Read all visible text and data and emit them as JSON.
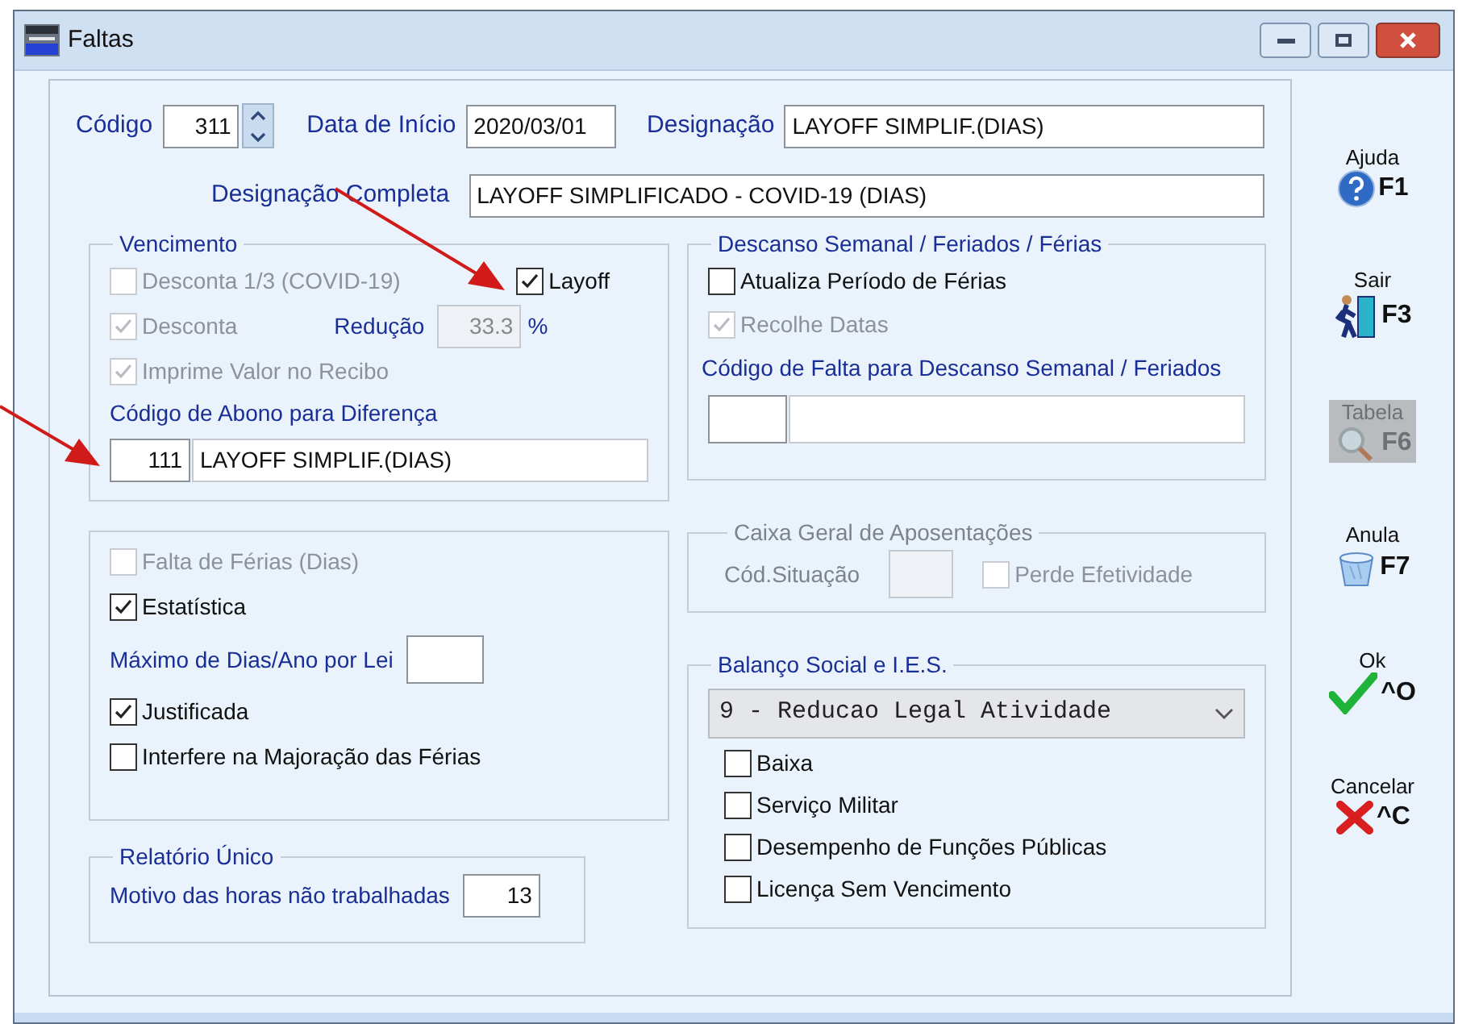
{
  "window": {
    "title": "Faltas"
  },
  "header": {
    "codigo": {
      "label": "Código",
      "value": "311"
    },
    "data_inicio": {
      "label": "Data de Início",
      "value": "2020/03/01"
    },
    "designacao": {
      "label": "Designação",
      "value": "LAYOFF SIMPLIF.(DIAS)"
    },
    "designacao_completa": {
      "label": "Designação Completa",
      "value": "LAYOFF SIMPLIFICADO - COVID-19 (DIAS)"
    }
  },
  "vencimento": {
    "title": "Vencimento",
    "desconta_terco": {
      "label": "Desconta 1/3  (COVID-19)",
      "checked": false,
      "disabled": true
    },
    "layoff": {
      "label": "Layoff",
      "checked": true,
      "disabled": false
    },
    "desconta": {
      "label": "Desconta",
      "checked": true,
      "disabled": true
    },
    "reducao": {
      "label": "Redução",
      "value": "33.3",
      "unit": "%",
      "disabled": true
    },
    "imprime": {
      "label": "Imprime Valor no Recibo",
      "checked": true,
      "disabled": true
    },
    "abono": {
      "label": "Código de Abono para Diferença",
      "code": "111",
      "description": "LAYOFF SIMPLIF.(DIAS)"
    }
  },
  "descanso": {
    "title": "Descanso Semanal / Feriados / Férias",
    "atualiza": {
      "label": "Atualiza Período de Férias",
      "checked": false,
      "disabled": false
    },
    "recolhe": {
      "label": "Recolhe Datas",
      "checked": true,
      "disabled": true
    },
    "codigo_falta": {
      "label": "Código de Falta para Descanso Semanal / Feriados"
    }
  },
  "ausencia": {
    "falta_ferias": {
      "label": "Falta de Férias (Dias)",
      "checked": false,
      "disabled": true
    },
    "estatistica": {
      "label": "Estatística",
      "checked": true,
      "disabled": false
    },
    "maximo": {
      "label": "Máximo de Dias/Ano por Lei"
    },
    "justificada": {
      "label": "Justificada",
      "checked": true,
      "disabled": false
    },
    "interfere": {
      "label": "Interfere na Majoração das Férias",
      "checked": false,
      "disabled": false
    }
  },
  "caixa_geral": {
    "title": "Caixa Geral de Aposentações",
    "disabled": true,
    "cod_situacao": {
      "label": "Cód.Situação"
    },
    "perde": {
      "label": "Perde Efetividade",
      "checked": false,
      "disabled": true
    }
  },
  "relatorio": {
    "title": "Relatório Único",
    "motivo": {
      "label": "Motivo das horas não trabalhadas",
      "value": "13"
    }
  },
  "balanco": {
    "title": "Balanço Social e I.E.S.",
    "select": {
      "value": "9 - Reducao Legal Atividade"
    },
    "options": [
      {
        "label": "Baixa",
        "checked": false,
        "disabled": false
      },
      {
        "label": "Serviço Militar",
        "checked": false,
        "disabled": false
      },
      {
        "label": "Desempenho de Funções Públicas",
        "checked": false,
        "disabled": false
      },
      {
        "label": "Licença Sem Vencimento",
        "checked": false,
        "disabled": false
      }
    ]
  },
  "toolbar": [
    {
      "kind": "help",
      "label": "Ajuda",
      "key": "F1",
      "disabled": false
    },
    {
      "kind": "exit",
      "label": "Sair",
      "key": "F3",
      "disabled": false
    },
    {
      "kind": "table",
      "label": "Tabela",
      "key": "F6",
      "disabled": true
    },
    {
      "kind": "undo",
      "label": "Anula",
      "key": "F7",
      "disabled": false
    },
    {
      "kind": "ok",
      "label": "Ok",
      "key": "^O",
      "disabled": false
    },
    {
      "kind": "cancel",
      "label": "Cancelar",
      "key": "^C",
      "disabled": false
    }
  ]
}
